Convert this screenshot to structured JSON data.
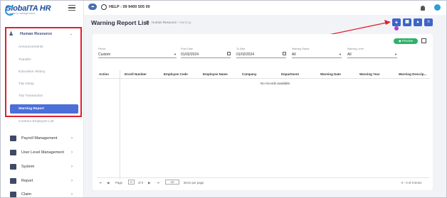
{
  "logo": {
    "word_main": "Global",
    "word_accent": "TA HR",
    "tagline": "guard to manage future"
  },
  "sidebar": {
    "hr_label": "Human Resource",
    "sub_items": [
      "Announcements",
      "Transfer",
      "Education History",
      "Trip Setup",
      "Trip Transaction"
    ],
    "active_item": "Warning Report",
    "contract_item": "Contract Employee List",
    "items": [
      {
        "label": "Payroll Management"
      },
      {
        "label": "User Level Management"
      },
      {
        "label": "System"
      },
      {
        "label": "Report"
      },
      {
        "label": "Claim"
      }
    ]
  },
  "topbar": {
    "help_text": "HELP : 09 9400 505 00"
  },
  "page": {
    "title": "Warning Report List",
    "crumb_1": "Human Resource",
    "crumb_sep": "/",
    "crumb_2": "Warning"
  },
  "toolbar": {
    "add": "+",
    "preview_label": "Preview"
  },
  "filters": {
    "period": {
      "label": "Period",
      "value": "Custom"
    },
    "from_date": {
      "label": "From Date",
      "value": "01/02/2024"
    },
    "to_date": {
      "label": "To Date",
      "value": "01/02/2024"
    },
    "warning_status": {
      "label": "Warning Status",
      "value": "All"
    },
    "warning_level": {
      "label": "Warning Level",
      "value": "All"
    }
  },
  "table": {
    "columns": [
      "Action",
      "Enroll Number",
      "Employee Code",
      "Employee Name",
      "Company",
      "Department",
      "Warning Date",
      "Warning Year",
      "Warning Descrip..."
    ],
    "empty_text": "No records available."
  },
  "pager": {
    "page_label": "Page",
    "page_value": "0",
    "of_text": "of 0",
    "page_size": "10",
    "items_per_page": "items per page",
    "summary": "0 - 0 of 0 items"
  },
  "colors": {
    "accent": "#3d64c8",
    "active_nav": "#4a6fd8",
    "annotation": "#e0202a",
    "preview": "#2cb26a"
  }
}
